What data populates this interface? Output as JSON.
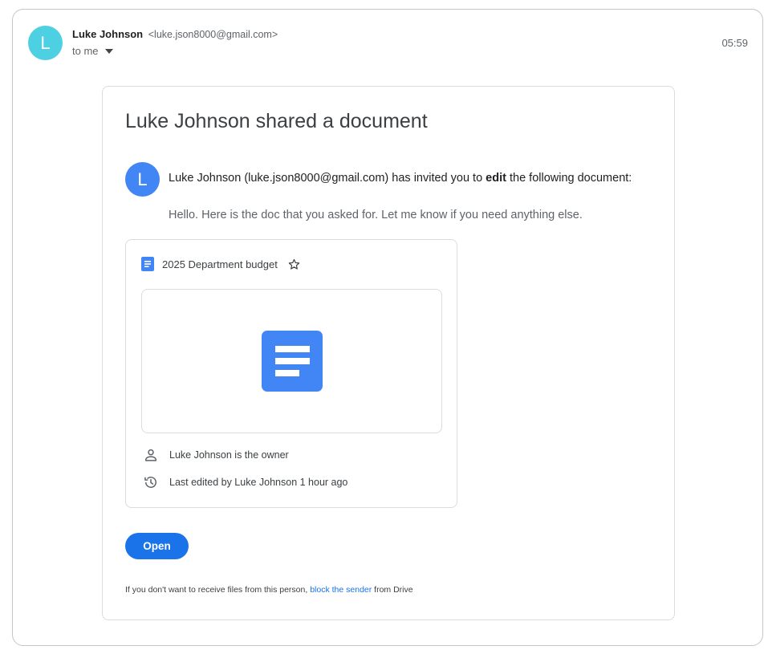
{
  "sender": {
    "avatar_letter": "L",
    "name": "Luke Johnson",
    "email": "<luke.json8000@gmail.com>",
    "recipient": "to me",
    "time": "05:59",
    "avatar_color": "#4dd0e1"
  },
  "card": {
    "title": "Luke Johnson shared a document",
    "invite_avatar_letter": "L",
    "invite_before": "Luke Johnson (luke.json8000@gmail.com) has invited you to ",
    "invite_bold": "edit",
    "invite_after": " the following document:",
    "message": "Hello. Here is the doc that you asked for. Let me know if you need anything else."
  },
  "document": {
    "name": "2025 Department budget",
    "owner_text": "Luke Johnson is the owner",
    "edited_text": "Last edited by Luke Johnson 1 hour ago",
    "icon_color": "#4285f4"
  },
  "actions": {
    "open_label": "Open"
  },
  "footer": {
    "before": "If you don't want to receive files from this person, ",
    "link": "block the sender",
    "after": " from Drive"
  },
  "icons": {
    "caret": "chevron-down-icon",
    "doc": "google-docs-icon",
    "star": "star-icon",
    "person": "person-icon",
    "history": "history-icon"
  }
}
